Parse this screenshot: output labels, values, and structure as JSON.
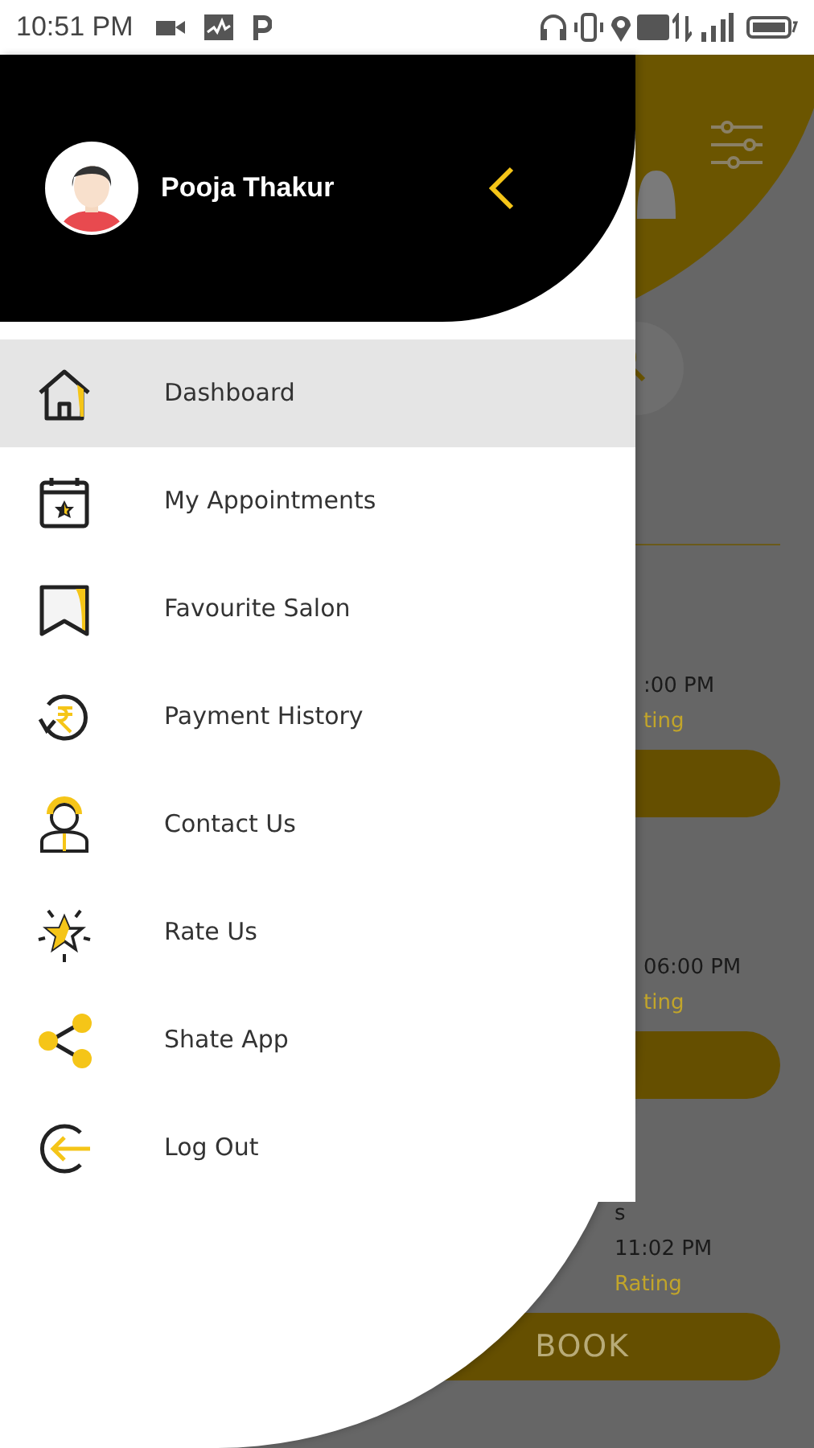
{
  "status_bar": {
    "time": "10:51 PM"
  },
  "background_screen": {
    "groups": [
      {
        "rows": [
          {
            "kind": "time",
            "text": ":00 PM"
          },
          {
            "kind": "rating",
            "text": "ting"
          },
          {
            "kind": "button"
          }
        ]
      },
      {
        "rows": [
          {
            "kind": "time",
            "text": "06:00 PM"
          },
          {
            "kind": "rating",
            "text": "ting"
          },
          {
            "kind": "button"
          }
        ]
      },
      {
        "rows": [
          {
            "kind": "text",
            "text": "s"
          },
          {
            "kind": "time",
            "text": "11:02 PM"
          },
          {
            "kind": "rating",
            "text": "Rating"
          },
          {
            "kind": "button",
            "text": "BOOK"
          }
        ]
      }
    ]
  },
  "drawer": {
    "user_name": "Pooja Thakur",
    "items": [
      {
        "label": "Dashboard",
        "selected": true,
        "kind": "home"
      },
      {
        "label": "My Appointments",
        "selected": false,
        "kind": "calendar"
      },
      {
        "label": "Favourite Salon",
        "selected": false,
        "kind": "bookmark"
      },
      {
        "label": "Payment History",
        "selected": false,
        "kind": "payment"
      },
      {
        "label": "Contact Us",
        "selected": false,
        "kind": "support"
      },
      {
        "label": "Rate Us",
        "selected": false,
        "kind": "star"
      },
      {
        "label": "Shate App",
        "selected": false,
        "kind": "share"
      },
      {
        "label": "Log Out",
        "selected": false,
        "kind": "logout"
      }
    ]
  }
}
